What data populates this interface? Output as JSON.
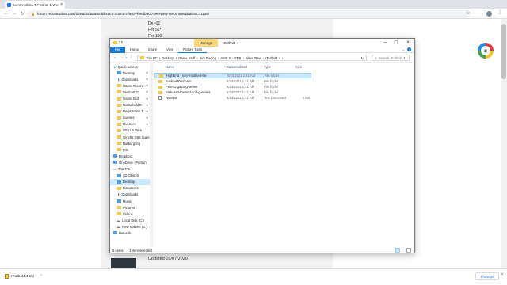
{
  "browser": {
    "tab_title": "Automobilista 2 Custom Force F...",
    "url": "forum.reizastudios.com/threads/automobilista-2-custom-force-feedback-overview-recommendations.11135/"
  },
  "page": {
    "lines": [
      "Dn -02",
      "Fer 50*",
      "Fer 100"
    ],
    "updated": "Updated 05/07/2020"
  },
  "downloads": {
    "file": "rFutbol4.4.zip",
    "show_all": "Show all"
  },
  "explorer": {
    "window_title": "rFutbol4.4",
    "manage_tab": "Manage",
    "ribbon_tabs": [
      "File",
      "Home",
      "Share",
      "View",
      "Picture Tools"
    ],
    "path": [
      "This PC",
      "Desktop",
      "Game Stuff",
      "Sim Racing",
      "AMS 2",
      "FFB",
      "Silver Raw",
      "rFutbol4.4"
    ],
    "search_placeholder": "Search rFutbol4.4",
    "columns": [
      "Name",
      "Date modified",
      "Type",
      "Size"
    ],
    "files": [
      {
        "name": "HighEnd - non-modified-file",
        "date": "5/23/2021 1:41 AM",
        "type": "File folder",
        "size": "",
        "folder": true,
        "selected": true
      },
      {
        "name": "Fusko-t300-fx-etc",
        "date": "5/23/2021 1:41 AM",
        "type": "File folder",
        "size": "",
        "folder": true
      },
      {
        "name": "PeterG-g920-g-series",
        "date": "5/23/2021 1:41 AM",
        "type": "File folder",
        "size": "",
        "folder": true
      },
      {
        "name": "Slakasso-lowend-and-g-series",
        "date": "5/23/2021 1:41 AM",
        "type": "File folder",
        "size": "",
        "folder": true
      },
      {
        "name": "Note.txt",
        "date": "5/23/2021 1:41 AM",
        "type": "Text Document",
        "size": "1 KB",
        "folder": false
      }
    ],
    "nav": [
      {
        "label": "Quick access",
        "kind": "star"
      },
      {
        "label": "Desktop",
        "kind": "blue",
        "pin": true
      },
      {
        "label": "Downloads",
        "kind": "dl",
        "pin": true
      },
      {
        "label": "Game Record",
        "kind": "folder",
        "pin": true
      },
      {
        "label": "Beeloutt 27",
        "kind": "folder",
        "pin": true
      },
      {
        "label": "Game Stuff",
        "kind": "folder",
        "pin": true
      },
      {
        "label": "Household E",
        "kind": "folder",
        "pin": true
      },
      {
        "label": "Registration T",
        "kind": "folder",
        "pin": true
      },
      {
        "label": "Liveries",
        "kind": "folder",
        "pin": true
      },
      {
        "label": "Overides",
        "kind": "folder",
        "pin": true
      },
      {
        "label": "G84 LA Pare",
        "kind": "folder"
      },
      {
        "label": "Ginetta G55 Supe",
        "kind": "folder"
      },
      {
        "label": "Nurburgring",
        "kind": "folder"
      },
      {
        "label": "Pits",
        "kind": "folder"
      },
      {
        "label": "Dropbox",
        "kind": "blue"
      },
      {
        "label": "OneDrive - Person",
        "kind": "blue"
      },
      {
        "label": "This PC",
        "kind": "pc"
      },
      {
        "label": "3D Objects",
        "kind": "blue"
      },
      {
        "label": "Desktop",
        "kind": "blue",
        "active": true
      },
      {
        "label": "Documents",
        "kind": "folder"
      },
      {
        "label": "Downloads",
        "kind": "dl"
      },
      {
        "label": "Music",
        "kind": "blue"
      },
      {
        "label": "Pictures",
        "kind": "folder"
      },
      {
        "label": "Videos",
        "kind": "folder"
      },
      {
        "label": "Local Disk (C:)",
        "kind": "disk"
      },
      {
        "label": "New Volume (E:)",
        "kind": "disk"
      },
      {
        "label": "Network",
        "kind": "blue"
      }
    ],
    "status": {
      "items": "5 items",
      "selected": "1 item selected"
    }
  }
}
